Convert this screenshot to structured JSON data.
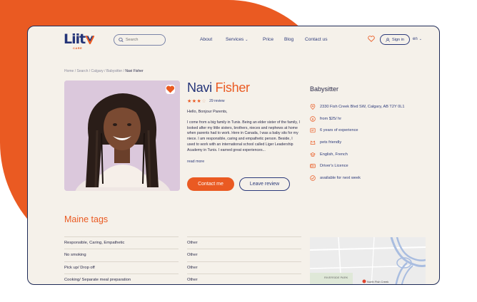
{
  "brand": {
    "name": "Liit",
    "sub": "CARE"
  },
  "search": {
    "placeholder": "Search"
  },
  "nav": {
    "about": "About",
    "services": "Services",
    "price": "Price",
    "blog": "Blog",
    "contact": "Contact us"
  },
  "header": {
    "signin": "Sign in",
    "lang": "en"
  },
  "breadcrumb": {
    "items": [
      "Home",
      "Search",
      "Calgary",
      "Babysitter"
    ],
    "current": "Navi Fisher"
  },
  "profile": {
    "first_name": "Navi",
    "last_name": "Fisher",
    "rating": 3,
    "rating_max": 4,
    "reviews": "29 review",
    "greeting": "Hello, Bonjour Parents,",
    "bio": "I come from a big family in Tunis. Being an elder sister of the family, I looked after my little sisters, brothers, nieces and nephews at home when parents had to work. Here in Canada, I was a baby sits for my niece. I am responsible, caring and empathetic person. Beside, I used to work with an international school called Liger Leadership Academy in Tunis. I earned great experiences...",
    "read_more": "read more",
    "contact_button": "Contact me",
    "review_button": "Leave review"
  },
  "details": {
    "role": "Babysitter",
    "address": "2330 Fish Creek Blvd SW, Calgary, AB T2Y 0L1",
    "rate": "from $25/ hr",
    "experience": "6 years of experience",
    "pets": "pets friendly",
    "languages": "English, French",
    "licence": "Driver's Licence",
    "availability": "available for next week"
  },
  "tags": {
    "title": "Maine tags",
    "rows": [
      {
        "name": "Responsible, Caring, Empathetic",
        "value": "Other"
      },
      {
        "name": "No smoking",
        "value": "Other"
      },
      {
        "name": "Pick up/ Drop off",
        "value": "Other"
      },
      {
        "name": "Cooking/ Separate meal preparation",
        "value": "Other"
      }
    ]
  },
  "map": {
    "label": "RIVERSIDE PARK",
    "place": "North Fish Creek"
  },
  "colors": {
    "accent": "#ea5a22",
    "primary": "#243478",
    "background": "#f5f1ea"
  }
}
